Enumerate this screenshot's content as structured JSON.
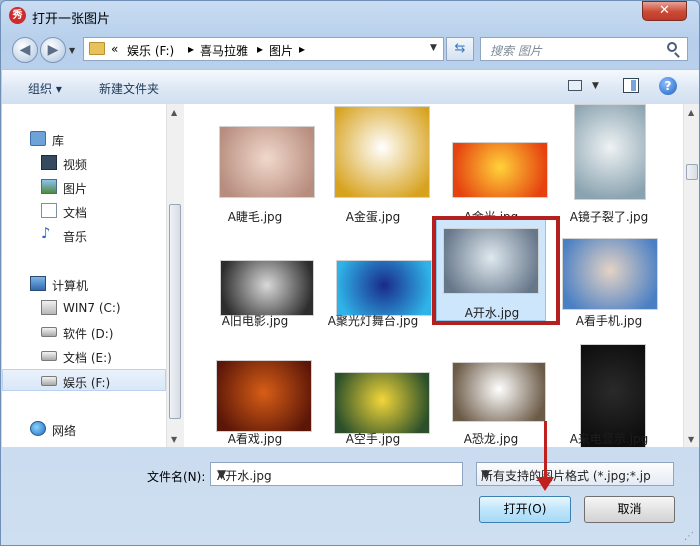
{
  "window": {
    "title": "打开一张图片",
    "app_icon_glyph": "秀",
    "close_glyph": "✕"
  },
  "nav": {
    "back_glyph": "◀",
    "forward_glyph": "▶"
  },
  "address": {
    "overflow": "«",
    "crumbs": [
      "娱乐 (F:)",
      "喜马拉雅",
      "图片"
    ],
    "separator": "▸"
  },
  "search": {
    "placeholder": "搜索 图片"
  },
  "toolbar": {
    "organize": "组织 ▾",
    "new_folder": "新建文件夹",
    "help": "?"
  },
  "sidebar": {
    "items": [
      {
        "label": "库",
        "icon": "library-icon"
      },
      {
        "label": "视频",
        "icon": "video-library-icon"
      },
      {
        "label": "图片",
        "icon": "pictures-library-icon"
      },
      {
        "label": "文档",
        "icon": "documents-library-icon"
      },
      {
        "label": "音乐",
        "icon": "music-library-icon",
        "glyph": "♪"
      },
      {
        "label": "计算机",
        "icon": "computer-icon"
      },
      {
        "label": "WIN7 (C:)",
        "icon": "system-drive-icon"
      },
      {
        "label": "软件 (D:)",
        "icon": "drive-icon"
      },
      {
        "label": "文档 (E:)",
        "icon": "drive-icon"
      },
      {
        "label": "娱乐 (F:)",
        "icon": "drive-icon",
        "selected": true
      },
      {
        "label": "网络",
        "icon": "network-icon"
      }
    ]
  },
  "files": [
    {
      "name": "A睫毛.jpg",
      "thumb_colors": [
        "#f1d8cc",
        "#b78d7e"
      ]
    },
    {
      "name": "A金蛋.jpg",
      "thumb_colors": [
        "#ffffff",
        "#d7a21e"
      ]
    },
    {
      "name": "A金光.jpg",
      "thumb_colors": [
        "#ffd23a",
        "#e5420f"
      ]
    },
    {
      "name": "A镜子裂了.jpg",
      "thumb_colors": [
        "#eef2f4",
        "#8aa3b0"
      ]
    },
    {
      "name": "A旧电影.jpg",
      "thumb_colors": [
        "#d9d9d9",
        "#2d2d2d"
      ]
    },
    {
      "name": "A聚光灯舞台.jpg",
      "thumb_colors": [
        "#1a2a8a",
        "#2fb3e8"
      ]
    },
    {
      "name": "A开水.jpg",
      "thumb_colors": [
        "#dfe8ef",
        "#66778a"
      ],
      "selected": true
    },
    {
      "name": "A看手机.jpg",
      "thumb_colors": [
        "#e3d3c5",
        "#4a7fc4"
      ]
    },
    {
      "name": "A看戏.jpg",
      "thumb_colors": [
        "#d75e16",
        "#5b1608"
      ]
    },
    {
      "name": "A空手.jpg",
      "thumb_colors": [
        "#f2d63a",
        "#2a4f2a"
      ]
    },
    {
      "name": "A恐龙.jpg",
      "thumb_colors": [
        "#ffffff",
        "#6b5a46"
      ]
    },
    {
      "name": "A来电显示.jpg",
      "thumb_colors": [
        "#2a2a2a",
        "#0d0d0d"
      ]
    }
  ],
  "bottom": {
    "filename_label": "文件名(N):",
    "filename_value": "A开水.jpg",
    "filetype_value": "所有支持的图片格式 (*.jpg;*.jp",
    "open_label": "打开(O)",
    "cancel_label": "取消"
  },
  "colors": {
    "highlight_box": "#b3201e",
    "selection": "#cde6fb"
  }
}
